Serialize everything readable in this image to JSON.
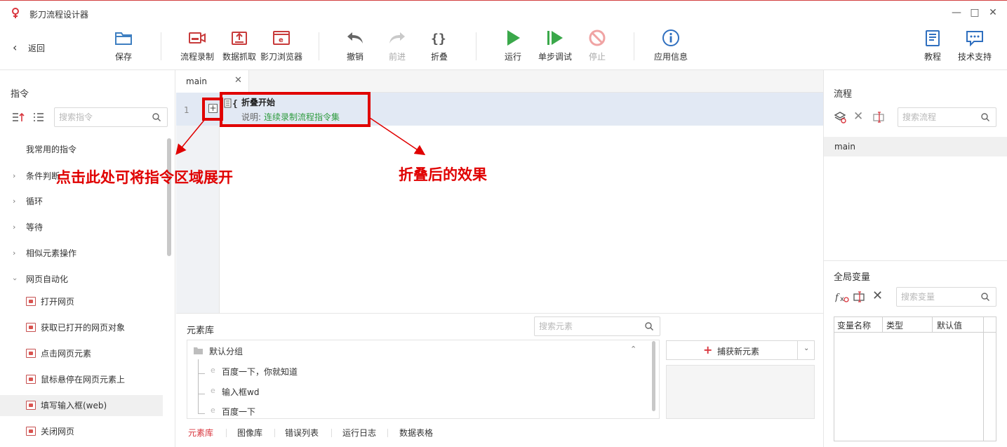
{
  "window": {
    "title": "影刀流程设计器"
  },
  "toolbar": {
    "back": "返回",
    "save": "保存",
    "record": "流程录制",
    "scrape": "数据抓取",
    "browser": "影刀浏览器",
    "undo": "撤销",
    "redo": "前进",
    "fold": "折叠",
    "run": "运行",
    "step_debug": "单步调试",
    "stop": "停止",
    "app_info": "应用信息",
    "tutorial": "教程",
    "support": "技术支持"
  },
  "left_panel": {
    "title": "指令",
    "search_placeholder": "搜索指令",
    "groups": [
      "我常用的指令",
      "条件判断",
      "循环",
      "等待",
      "相似元素操作",
      "网页自动化"
    ],
    "web_items": [
      "打开网页",
      "获取已打开的网页对象",
      "点击网页元素",
      "鼠标悬停在网页元素上",
      "填写输入框(web)",
      "关闭网页"
    ]
  },
  "editor": {
    "tab": "main",
    "line_number": "1",
    "fold_block": {
      "title": "折叠开始",
      "desc_label": "说明:",
      "desc_value": "连续录制流程指令集"
    }
  },
  "annotations": {
    "expand_hint": "点击此处可将指令区域展开",
    "fold_effect": "折叠后的效果"
  },
  "element_library": {
    "title": "元素库",
    "search_placeholder": "搜索元素",
    "group": "默认分组",
    "items": [
      "百度一下，你就知道",
      "输入框wd",
      "百度一下"
    ],
    "capture_button": "捕获新元素",
    "tabs": [
      "元素库",
      "图像库",
      "错误列表",
      "运行日志",
      "数据表格"
    ]
  },
  "right_panel": {
    "flow_title": "流程",
    "flow_search_placeholder": "搜索流程",
    "flows": [
      "main"
    ],
    "vars_title": "全局变量",
    "vars_search_placeholder": "搜索变量",
    "var_columns": [
      "变量名称",
      "类型",
      "默认值"
    ]
  },
  "colors": {
    "accent": "#d9363e",
    "annotation": "#e00000",
    "link_green": "#2e9b3e",
    "run_green": "#3aa84a"
  }
}
